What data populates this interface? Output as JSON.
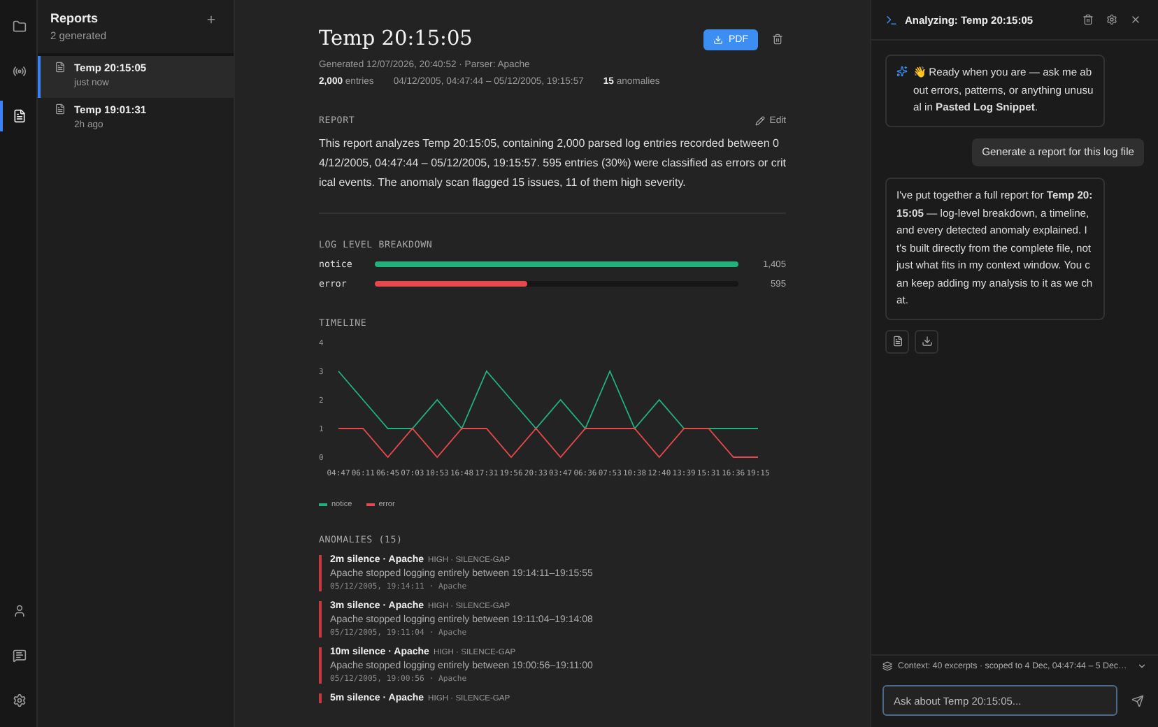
{
  "rail": {
    "items": [
      {
        "selected": false
      },
      {
        "selected": false
      },
      {
        "selected": true
      }
    ]
  },
  "sidebar": {
    "title": "Reports",
    "subtitle": "2 generated",
    "items": [
      {
        "title": "Temp 20:15:05",
        "time": "just now",
        "selected": true
      },
      {
        "title": "Temp 19:01:31",
        "time": "2h ago",
        "selected": false
      }
    ]
  },
  "report": {
    "title": "Temp 20:15:05",
    "pdf_button": "PDF",
    "generated": "Generated 12/07/2026, 20:40:52 · Parser: Apache",
    "stats": [
      {
        "value": "2,000",
        "label": "entries"
      },
      {
        "label": "04/12/2005, 04:47:44 – 05/12/2005, 19:15:57"
      },
      {
        "value": "15",
        "label": "anomalies"
      }
    ],
    "section_report": "REPORT",
    "edit": "Edit",
    "summary": "This report analyzes Temp 20:15:05, containing 2,000 parsed log entries recorded between 04/12/2005, 04:47:44 – 05/12/2005, 19:15:57. 595 entries (30%) were classified as errors or critical events. The anomaly scan flagged 15 issues, 11 of them high severity.",
    "section_levels": "LOG LEVEL BREAKDOWN",
    "levels": [
      {
        "name": "notice",
        "count": "1,405",
        "level": 1.0,
        "color": "#22b07d"
      },
      {
        "name": "error",
        "count": "595",
        "level": 0.42,
        "color": "#e5484d"
      }
    ],
    "section_timeline": "TIMELINE",
    "timeline": {
      "chart_data": {
        "type": "line",
        "categories": [
          "04:47",
          "06:11",
          "06:45",
          "07:03",
          "10:53",
          "16:48",
          "17:31",
          "19:56",
          "20:33",
          "03:47",
          "06:36",
          "07:53",
          "10:38",
          "12:40",
          "13:39",
          "15:31",
          "16:36",
          "19:15"
        ],
        "series": [
          {
            "name": "notice",
            "color": "#22b07d",
            "values": [
              3,
              2,
              1,
              1,
              2,
              1,
              3,
              2,
              1,
              2,
              1,
              3,
              1,
              2,
              1,
              1,
              1,
              1
            ]
          },
          {
            "name": "error",
            "color": "#e5484d",
            "values": [
              1,
              1,
              0,
              1,
              0,
              1,
              1,
              0,
              1,
              0,
              1,
              1,
              1,
              0,
              1,
              1,
              0,
              0
            ]
          }
        ],
        "ylim": [
          0,
          4
        ],
        "yticks": [
          0,
          1,
          2,
          3,
          4
        ]
      }
    },
    "section_anomalies": "ANOMALIES (15)",
    "anomalies": [
      {
        "title": "2m silence · Apache",
        "tags": "HIGH · SILENCE-GAP",
        "description": "Apache stopped logging entirely between 19:14:11–19:15:55",
        "meta": "05/12/2005, 19:14:11 · Apache"
      },
      {
        "title": "3m silence · Apache",
        "tags": "HIGH · SILENCE-GAP",
        "description": "Apache stopped logging entirely between 19:11:04–19:14:08",
        "meta": "05/12/2005, 19:11:04 · Apache"
      },
      {
        "title": "10m silence · Apache",
        "tags": "HIGH · SILENCE-GAP",
        "description": "Apache stopped logging entirely between 19:00:56–19:11:00",
        "meta": "05/12/2005, 19:00:56 · Apache"
      },
      {
        "title": "5m silence · Apache",
        "tags": "HIGH · SILENCE-GAP"
      }
    ]
  },
  "chat": {
    "title": "Analyzing: Temp 20:15:05",
    "messages": [
      {
        "kind": "assistant",
        "text": "👋 Ready when you are — ask me about errors, patterns, or anything unusual in **Pasted Log Snippet**.",
        "sparkle": true
      },
      {
        "kind": "user",
        "text": "Generate a report for this log file"
      },
      {
        "kind": "assistant",
        "text": "I've put together a full report for **Temp 20:15:05** — log-level breakdown, a timeline, and every detected anomaly explained. It's built directly from the complete file, not just what fits in my context window. You can keep adding my analysis to it as we chat.",
        "sparkle": false,
        "actions": true
      }
    ],
    "context": "Context: 40 excerpts · scoped to 4 Dec, 04:47:44 – 5 Dec…",
    "input_placeholder": "Ask about Temp 20:15:05..."
  }
}
